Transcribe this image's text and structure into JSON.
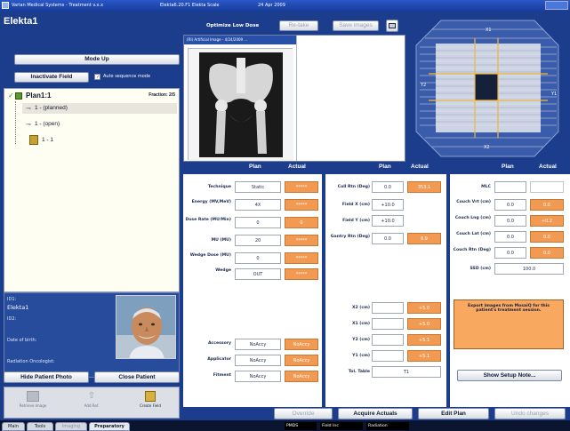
{
  "titlebar": {
    "app_title": "Varian Medical Systems - Treatment v.x.x",
    "field_scale": "Elekta6.20.F1 Elekta Scale",
    "date": "24 Apr 2009"
  },
  "patient": {
    "name": "Elekta1",
    "id1_label": "ID1:",
    "id1_value": "Elekta1",
    "id2_label": "ID2:",
    "dob_label": "Date of birth:",
    "oncologist_label": "Radiation Oncologist:"
  },
  "left_panel": {
    "mode_up": "Mode Up",
    "inactivate_field": "Inactivate Field",
    "auto_sequence": "Auto sequence mode",
    "hide_photo": "Hide Patient Photo",
    "close_patient": "Close Patient",
    "tray": [
      "Retrieve Image",
      "Add Ref.",
      "Create Field"
    ]
  },
  "tree": {
    "plan": "Plan1:1",
    "fraction": "Fraction: 2/5",
    "items": [
      "1 - (planned)",
      "1 - (open)",
      "1 - 1"
    ]
  },
  "toolbar": {
    "optimize": "Optimize Low Dose",
    "retake": "Re-take",
    "save_images": "Save images"
  },
  "image_panel": {
    "tab": "(RI) Artificial Image - 4/24/2009 ..."
  },
  "bev": {
    "x1": "X1",
    "x2": "X2",
    "y1": "Y1",
    "y2": "Y2"
  },
  "params": {
    "plan_hdr": "Plan",
    "actual_hdr": "Actual",
    "col1": [
      {
        "label": "Technique",
        "plan": "Static",
        "actual": "*****"
      },
      {
        "label": "Energy (MV,MeV)",
        "plan": "4X",
        "actual": "*****"
      },
      {
        "label": "Dose Rate (MU/Min)",
        "plan": "0",
        "actual": "0"
      },
      {
        "label": "MU (MU)",
        "plan": "20",
        "actual": "*****"
      },
      {
        "label": "Wedge Dose (MU)",
        "plan": "0",
        "actual": "*****"
      },
      {
        "label": "Wedge",
        "plan": "OUT",
        "actual": "*****"
      },
      {
        "label": "Accessory",
        "plan": "NoAccy",
        "actual": "NoAccy"
      },
      {
        "label": "Applicator",
        "plan": "NoAccy",
        "actual": "NoAccy"
      },
      {
        "label": "Fitment",
        "plan": "NoAccy",
        "actual": "NoAccy"
      }
    ],
    "col2": [
      {
        "label": "Coll Rtn (Deg)",
        "plan": "0.0",
        "actual": "353.1"
      },
      {
        "label": "Field X (cm)",
        "plan": "+10.0",
        "actual": ""
      },
      {
        "label": "Field Y (cm)",
        "plan": "+10.0",
        "actual": ""
      },
      {
        "label": "Gantry Rtn (Deg)",
        "plan": "0.0",
        "actual": "8.9"
      },
      {
        "label": "X2 (cm)",
        "plan": "",
        "actual": "+5.0"
      },
      {
        "label": "X1 (cm)",
        "plan": "",
        "actual": "+5.0"
      },
      {
        "label": "Y2 (cm)",
        "plan": "",
        "actual": "+5.1"
      },
      {
        "label": "Y1 (cm)",
        "plan": "",
        "actual": "+5.1"
      },
      {
        "label": "Tol. Table",
        "plan": "T1",
        "actual": ""
      }
    ],
    "col3": [
      {
        "label": "MLC",
        "plan": "",
        "actual": ""
      },
      {
        "label": "Couch Vrt (cm)",
        "plan": "0.0",
        "actual": "0.0"
      },
      {
        "label": "Couch Lng (cm)",
        "plan": "0.0",
        "actual": "+0.2"
      },
      {
        "label": "Couch Lat (cm)",
        "plan": "0.0",
        "actual": "0.0"
      },
      {
        "label": "Couch Rtn (Deg)",
        "plan": "0.0",
        "actual": "0.0"
      },
      {
        "label": "SSD (cm)",
        "plan": "100.0",
        "actual": ""
      }
    ],
    "message": "Export images from MosaiQ for this patient's treatment session.",
    "show_setup_note": "Show Setup Note..."
  },
  "actions": {
    "override": "Override",
    "acquire_actuals": "Acquire Actuals",
    "edit_plan": "Edit Plan",
    "undo_changes": "Undo changes"
  },
  "taskbar": {
    "tabs": [
      "Main",
      "Tools",
      "Imaging",
      "Preparatory"
    ],
    "status": [
      "PMDS",
      "Field Inc",
      "Radiation"
    ]
  },
  "colors": {
    "panel_blue": "#1c3d8c",
    "actual_orange": "#f29a52",
    "message_orange": "#f9a860"
  }
}
